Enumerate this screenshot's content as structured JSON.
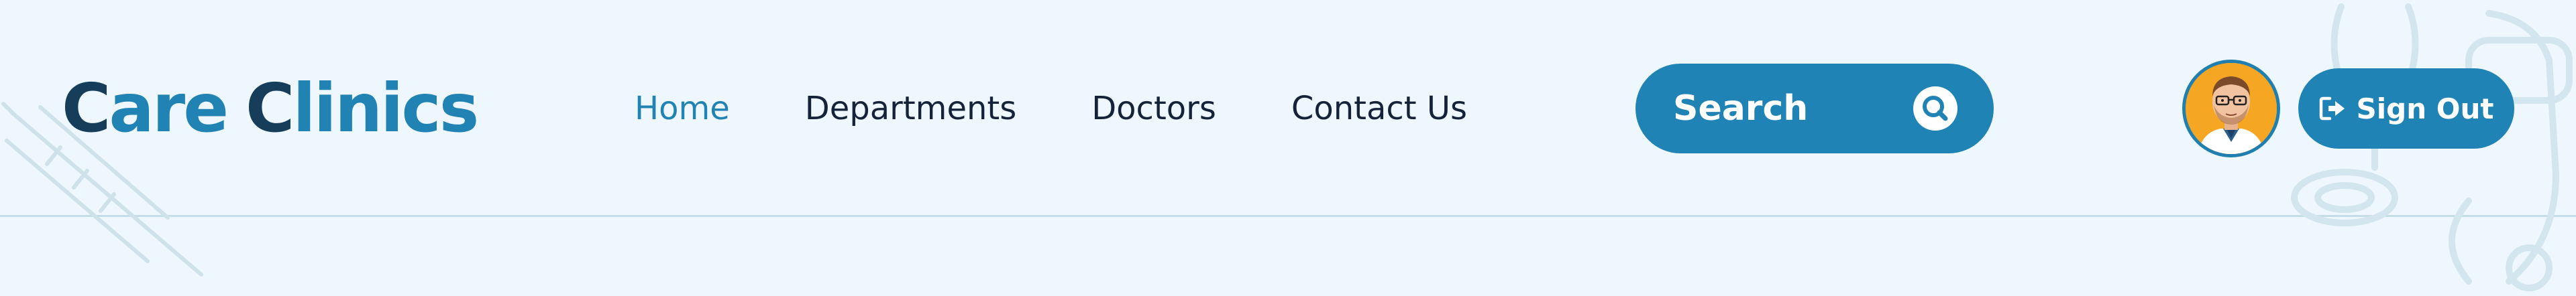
{
  "brand": {
    "first_letter": "C",
    "first_rest": "are",
    "second_letter": "C",
    "second_rest": "linics"
  },
  "nav": {
    "items": [
      {
        "label": "Home",
        "active": true
      },
      {
        "label": "Departments",
        "active": false
      },
      {
        "label": "Doctors",
        "active": false
      },
      {
        "label": "Contact Us",
        "active": false
      }
    ]
  },
  "search": {
    "label": "Search",
    "icon": "search-icon"
  },
  "user": {
    "avatar": "doctor-avatar"
  },
  "signout": {
    "label": "Sign Out",
    "icon": "sign-out-icon"
  },
  "colors": {
    "background": "#eef7fd",
    "primary": "#2083b5",
    "dark": "#163e5a",
    "text": "#14233a",
    "divider": "#c4dde8"
  }
}
